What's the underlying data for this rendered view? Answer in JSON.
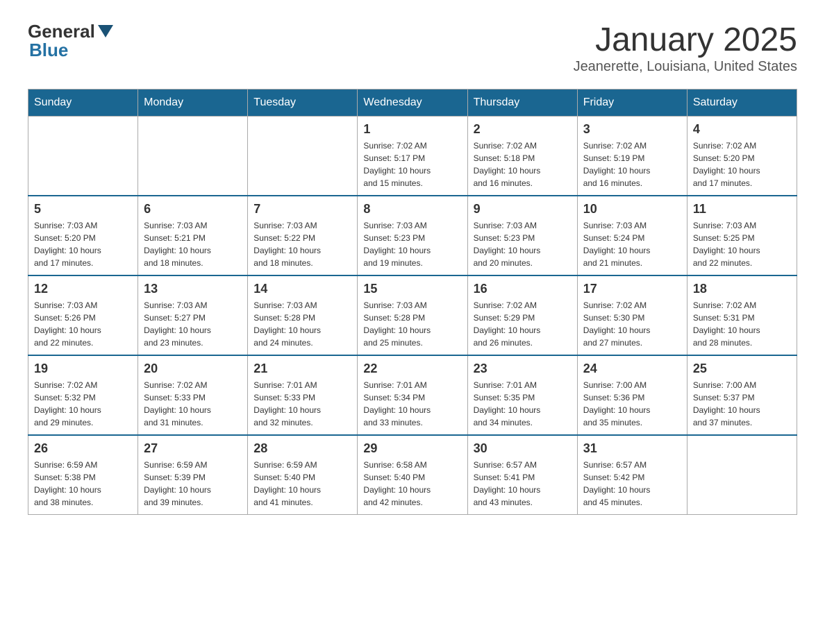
{
  "logo": {
    "general": "General",
    "blue": "Blue"
  },
  "title": "January 2025",
  "location": "Jeanerette, Louisiana, United States",
  "weekdays": [
    "Sunday",
    "Monday",
    "Tuesday",
    "Wednesday",
    "Thursday",
    "Friday",
    "Saturday"
  ],
  "weeks": [
    [
      {
        "day": "",
        "info": ""
      },
      {
        "day": "",
        "info": ""
      },
      {
        "day": "",
        "info": ""
      },
      {
        "day": "1",
        "info": "Sunrise: 7:02 AM\nSunset: 5:17 PM\nDaylight: 10 hours\nand 15 minutes."
      },
      {
        "day": "2",
        "info": "Sunrise: 7:02 AM\nSunset: 5:18 PM\nDaylight: 10 hours\nand 16 minutes."
      },
      {
        "day": "3",
        "info": "Sunrise: 7:02 AM\nSunset: 5:19 PM\nDaylight: 10 hours\nand 16 minutes."
      },
      {
        "day": "4",
        "info": "Sunrise: 7:02 AM\nSunset: 5:20 PM\nDaylight: 10 hours\nand 17 minutes."
      }
    ],
    [
      {
        "day": "5",
        "info": "Sunrise: 7:03 AM\nSunset: 5:20 PM\nDaylight: 10 hours\nand 17 minutes."
      },
      {
        "day": "6",
        "info": "Sunrise: 7:03 AM\nSunset: 5:21 PM\nDaylight: 10 hours\nand 18 minutes."
      },
      {
        "day": "7",
        "info": "Sunrise: 7:03 AM\nSunset: 5:22 PM\nDaylight: 10 hours\nand 18 minutes."
      },
      {
        "day": "8",
        "info": "Sunrise: 7:03 AM\nSunset: 5:23 PM\nDaylight: 10 hours\nand 19 minutes."
      },
      {
        "day": "9",
        "info": "Sunrise: 7:03 AM\nSunset: 5:23 PM\nDaylight: 10 hours\nand 20 minutes."
      },
      {
        "day": "10",
        "info": "Sunrise: 7:03 AM\nSunset: 5:24 PM\nDaylight: 10 hours\nand 21 minutes."
      },
      {
        "day": "11",
        "info": "Sunrise: 7:03 AM\nSunset: 5:25 PM\nDaylight: 10 hours\nand 22 minutes."
      }
    ],
    [
      {
        "day": "12",
        "info": "Sunrise: 7:03 AM\nSunset: 5:26 PM\nDaylight: 10 hours\nand 22 minutes."
      },
      {
        "day": "13",
        "info": "Sunrise: 7:03 AM\nSunset: 5:27 PM\nDaylight: 10 hours\nand 23 minutes."
      },
      {
        "day": "14",
        "info": "Sunrise: 7:03 AM\nSunset: 5:28 PM\nDaylight: 10 hours\nand 24 minutes."
      },
      {
        "day": "15",
        "info": "Sunrise: 7:03 AM\nSunset: 5:28 PM\nDaylight: 10 hours\nand 25 minutes."
      },
      {
        "day": "16",
        "info": "Sunrise: 7:02 AM\nSunset: 5:29 PM\nDaylight: 10 hours\nand 26 minutes."
      },
      {
        "day": "17",
        "info": "Sunrise: 7:02 AM\nSunset: 5:30 PM\nDaylight: 10 hours\nand 27 minutes."
      },
      {
        "day": "18",
        "info": "Sunrise: 7:02 AM\nSunset: 5:31 PM\nDaylight: 10 hours\nand 28 minutes."
      }
    ],
    [
      {
        "day": "19",
        "info": "Sunrise: 7:02 AM\nSunset: 5:32 PM\nDaylight: 10 hours\nand 29 minutes."
      },
      {
        "day": "20",
        "info": "Sunrise: 7:02 AM\nSunset: 5:33 PM\nDaylight: 10 hours\nand 31 minutes."
      },
      {
        "day": "21",
        "info": "Sunrise: 7:01 AM\nSunset: 5:33 PM\nDaylight: 10 hours\nand 32 minutes."
      },
      {
        "day": "22",
        "info": "Sunrise: 7:01 AM\nSunset: 5:34 PM\nDaylight: 10 hours\nand 33 minutes."
      },
      {
        "day": "23",
        "info": "Sunrise: 7:01 AM\nSunset: 5:35 PM\nDaylight: 10 hours\nand 34 minutes."
      },
      {
        "day": "24",
        "info": "Sunrise: 7:00 AM\nSunset: 5:36 PM\nDaylight: 10 hours\nand 35 minutes."
      },
      {
        "day": "25",
        "info": "Sunrise: 7:00 AM\nSunset: 5:37 PM\nDaylight: 10 hours\nand 37 minutes."
      }
    ],
    [
      {
        "day": "26",
        "info": "Sunrise: 6:59 AM\nSunset: 5:38 PM\nDaylight: 10 hours\nand 38 minutes."
      },
      {
        "day": "27",
        "info": "Sunrise: 6:59 AM\nSunset: 5:39 PM\nDaylight: 10 hours\nand 39 minutes."
      },
      {
        "day": "28",
        "info": "Sunrise: 6:59 AM\nSunset: 5:40 PM\nDaylight: 10 hours\nand 41 minutes."
      },
      {
        "day": "29",
        "info": "Sunrise: 6:58 AM\nSunset: 5:40 PM\nDaylight: 10 hours\nand 42 minutes."
      },
      {
        "day": "30",
        "info": "Sunrise: 6:57 AM\nSunset: 5:41 PM\nDaylight: 10 hours\nand 43 minutes."
      },
      {
        "day": "31",
        "info": "Sunrise: 6:57 AM\nSunset: 5:42 PM\nDaylight: 10 hours\nand 45 minutes."
      },
      {
        "day": "",
        "info": ""
      }
    ]
  ]
}
